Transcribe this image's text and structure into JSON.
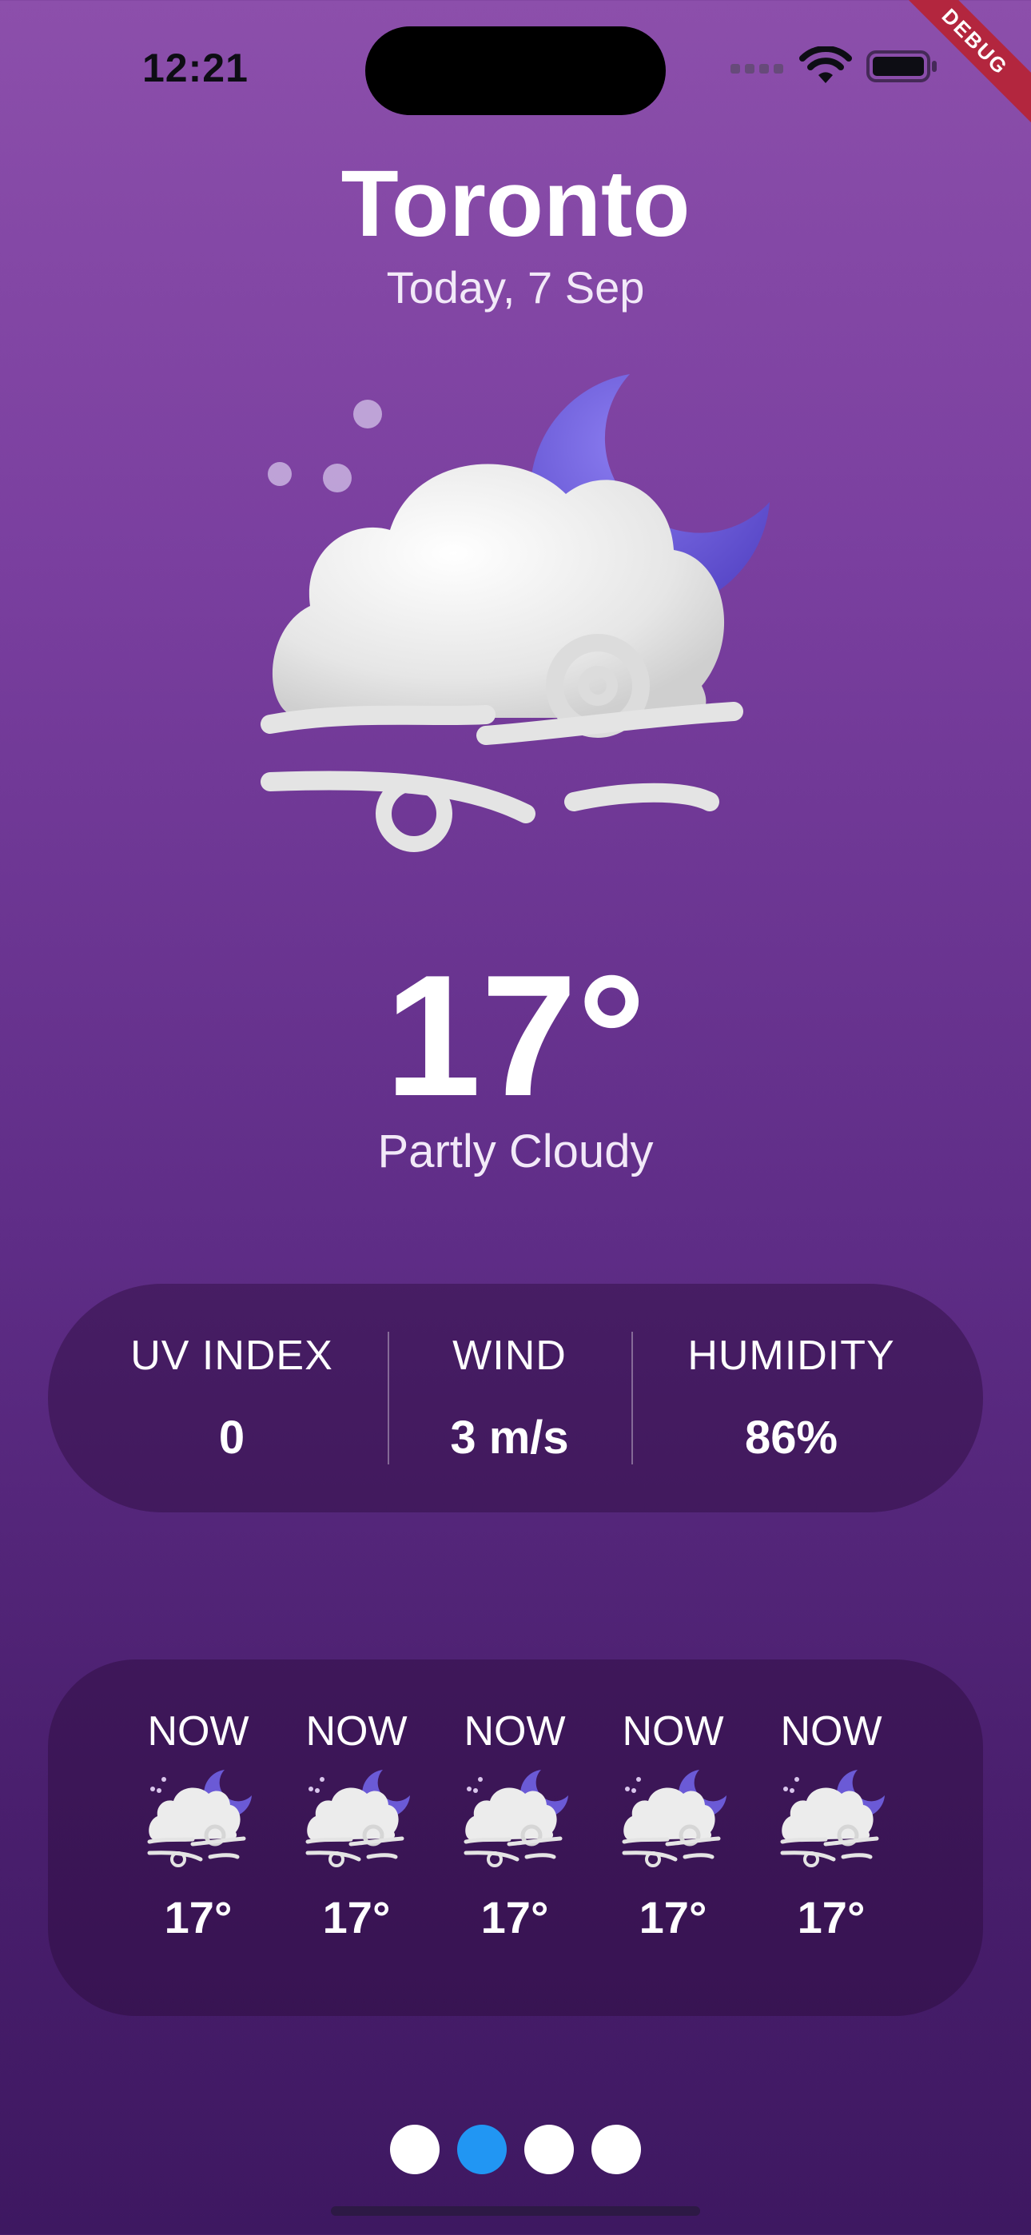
{
  "status_bar": {
    "time": "12:21",
    "debug_badge": "DEBUG"
  },
  "location": {
    "city": "Toronto",
    "date": "Today, 7 Sep"
  },
  "current": {
    "temperature": "17°",
    "condition": "Partly Cloudy",
    "icon": "partly-cloudy-night-wind-icon"
  },
  "stats": [
    {
      "label": "UV INDEX",
      "value": "0"
    },
    {
      "label": "WIND",
      "value": "3 m/s"
    },
    {
      "label": "HUMIDITY",
      "value": "86%"
    }
  ],
  "hourly": [
    {
      "label": "NOW",
      "temp": "17°",
      "icon": "partly-cloudy-night-wind-icon"
    },
    {
      "label": "NOW",
      "temp": "17°",
      "icon": "partly-cloudy-night-wind-icon"
    },
    {
      "label": "NOW",
      "temp": "17°",
      "icon": "partly-cloudy-night-wind-icon"
    },
    {
      "label": "NOW",
      "temp": "17°",
      "icon": "partly-cloudy-night-wind-icon"
    },
    {
      "label": "NOW",
      "temp": "17°",
      "icon": "partly-cloudy-night-wind-icon"
    }
  ],
  "pager": {
    "count": 4,
    "active_index": 1
  },
  "colors": {
    "background_top": "#8c4fab",
    "background_bottom": "#3e1861",
    "card": "rgba(40,10,55,0.42)",
    "page_dot_active": "#2196f3",
    "page_dot_inactive": "#ffffff",
    "moon": "#6b5ad6",
    "cloud": "#ececec"
  }
}
